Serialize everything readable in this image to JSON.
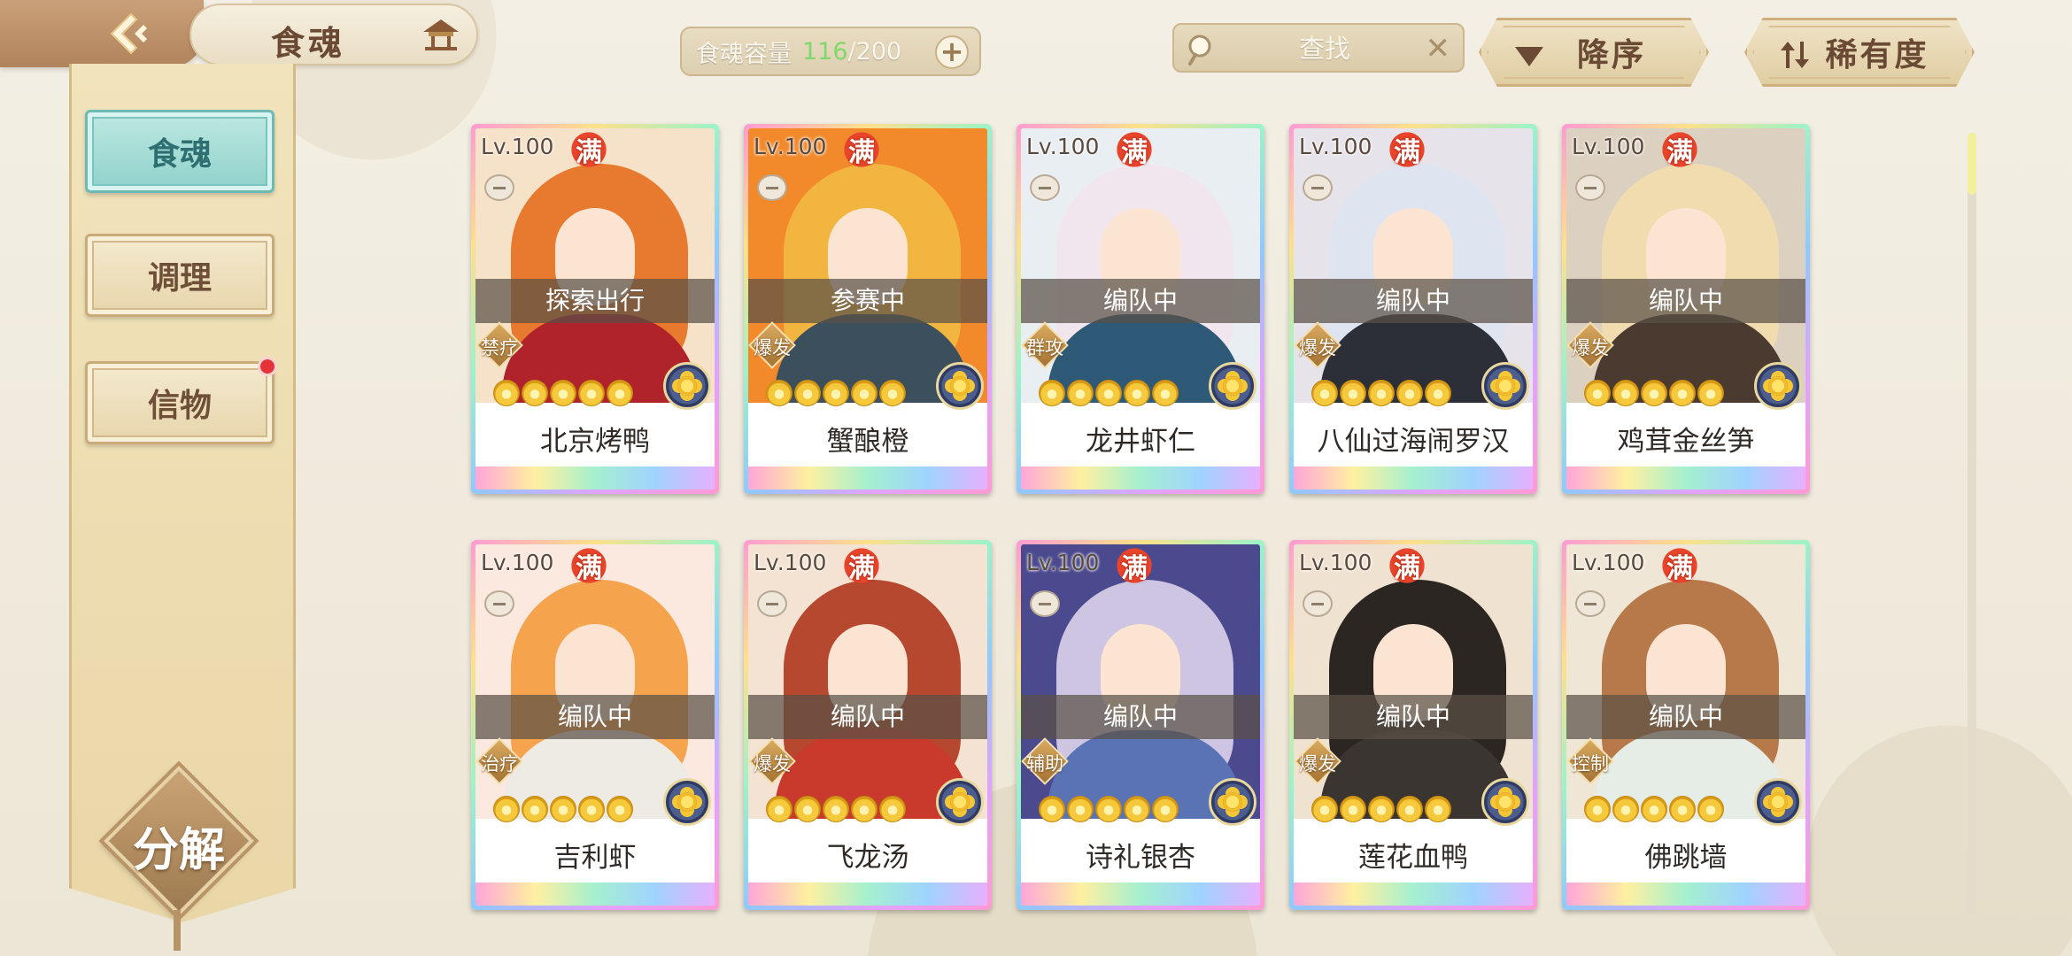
{
  "header": {
    "title": "食魂"
  },
  "capacity": {
    "label": "食魂容量",
    "current": "116",
    "separator": "/",
    "max": "200",
    "plus": "+"
  },
  "search": {
    "placeholder": "查找",
    "clear": "✕"
  },
  "sort": {
    "order_label": "降序",
    "rarity_label": "稀有度"
  },
  "sidebar": {
    "items": [
      {
        "label": "食魂",
        "active": true
      },
      {
        "label": "调理",
        "active": false
      },
      {
        "label": "信物",
        "active": false,
        "badge": true
      }
    ],
    "decompose_label": "分解"
  },
  "cards": [
    {
      "level": "Lv.100",
      "max": "满",
      "status": "探索出行",
      "role": "禁疗",
      "name": "北京烤鸭",
      "stars": 5,
      "hair": "#e77a2e",
      "robe": "#b0232a",
      "bg": "#f6e1c9"
    },
    {
      "level": "Lv.100",
      "max": "满",
      "status": "参赛中",
      "role": "爆发",
      "name": "蟹酿橙",
      "stars": 5,
      "hair": "#f2b640",
      "robe": "#3b4f5c",
      "bg": "#f28a2c"
    },
    {
      "level": "Lv.100",
      "max": "满",
      "status": "编队中",
      "role": "群攻",
      "name": "龙井虾仁",
      "stars": 5,
      "hair": "#f1e6ee",
      "robe": "#2e5a78",
      "bg": "#e9eef2"
    },
    {
      "level": "Lv.100",
      "max": "满",
      "status": "编队中",
      "role": "爆发",
      "name": "八仙过海闹罗汉",
      "stars": 5,
      "hair": "#dfe4f1",
      "robe": "#2c2e38",
      "bg": "#e6e3ea"
    },
    {
      "level": "Lv.100",
      "max": "满",
      "status": "编队中",
      "role": "爆发",
      "name": "鸡茸金丝笋",
      "stars": 5,
      "hair": "#f0dcae",
      "robe": "#4a3a30",
      "bg": "#dcd1c1"
    },
    {
      "level": "Lv.100",
      "max": "满",
      "status": "编队中",
      "role": "治疗",
      "name": "吉利虾",
      "stars": 5,
      "hair": "#f6a34e",
      "robe": "#eeeae4",
      "bg": "#fbe8de"
    },
    {
      "level": "Lv.100",
      "max": "满",
      "status": "编队中",
      "role": "爆发",
      "name": "飞龙汤",
      "stars": 5,
      "hair": "#b5482e",
      "robe": "#c93a2c",
      "bg": "#f4e3d3"
    },
    {
      "level": "Lv.100",
      "max": "满",
      "status": "编队中",
      "role": "辅助",
      "name": "诗礼银杏",
      "stars": 5,
      "hair": "#cdc5e2",
      "robe": "#5a73b4",
      "bg": "#4b4a8e"
    },
    {
      "level": "Lv.100",
      "max": "满",
      "status": "编队中",
      "role": "爆发",
      "name": "莲花血鸭",
      "stars": 5,
      "hair": "#2c2622",
      "robe": "#3a3531",
      "bg": "#f0e2d1"
    },
    {
      "level": "Lv.100",
      "max": "满",
      "status": "编队中",
      "role": "控制",
      "name": "佛跳墙",
      "stars": 5,
      "hair": "#b7794a",
      "robe": "#e6ece6",
      "bg": "#efe6d6"
    }
  ]
}
